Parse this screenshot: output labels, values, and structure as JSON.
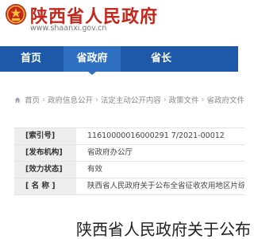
{
  "header": {
    "site_name": "陕西省人民政府",
    "site_url": "www.shaanxi.gov.cn",
    "emblem_icon": "national-emblem-icon"
  },
  "nav": {
    "items": [
      {
        "label": "首页"
      },
      {
        "label": "省政府",
        "active": true
      },
      {
        "label": "省长"
      }
    ],
    "bar_color": "#1d59a8",
    "active_color": "#2f6fc1"
  },
  "breadcrumb": {
    "home_icon": "house-icon",
    "items": [
      "首页",
      "政府信息公开",
      "法定主动公开内容",
      "政策文件",
      "省政府文件"
    ]
  },
  "info": {
    "rows": [
      {
        "label": "[索引号]",
        "value": "11610000016000291 7/2021-00012"
      },
      {
        "label": "[发布机构]",
        "value": "省政府办公厅"
      },
      {
        "label": "[效力状态]",
        "value": "有效"
      },
      {
        "label": "[ 名   称 ]",
        "value": "陕西省人民政府关于公布全省征收农用地区片综合地价"
      }
    ]
  },
  "document": {
    "title": "陕西省人民政府关于公布"
  },
  "colors": {
    "brand_red": "#c5271d"
  }
}
